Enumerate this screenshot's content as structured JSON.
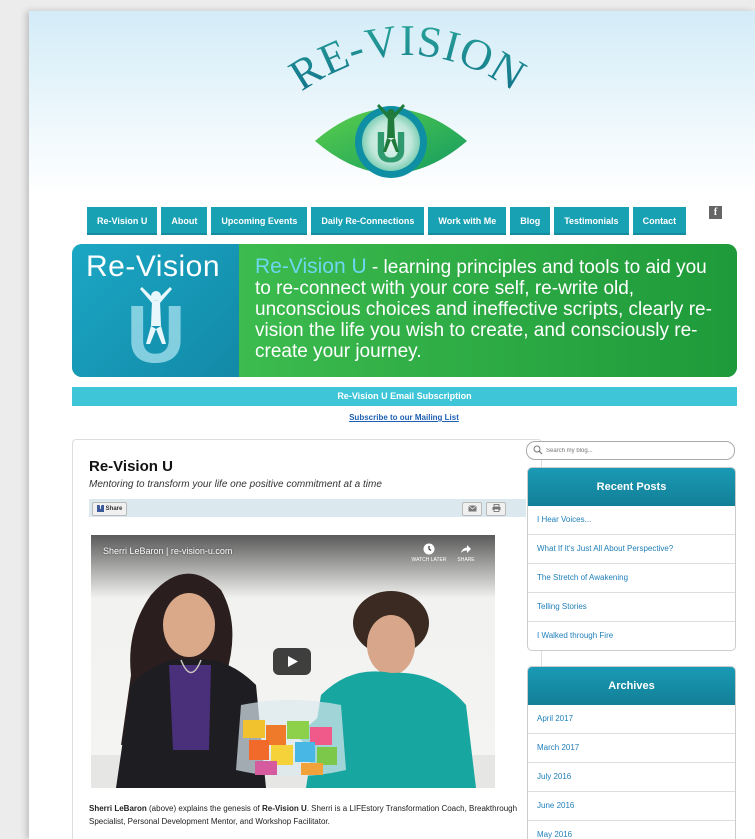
{
  "logo": {
    "title": "RE-VISION",
    "letter": "U"
  },
  "nav": {
    "items": [
      {
        "label": "Re-Vision U"
      },
      {
        "label": "About"
      },
      {
        "label": "Upcoming Events"
      },
      {
        "label": "Daily Re-Connections"
      },
      {
        "label": "Work with Me"
      },
      {
        "label": "Blog"
      },
      {
        "label": "Testimonials"
      },
      {
        "label": "Contact"
      }
    ],
    "facebook_glyph": "f"
  },
  "banner": {
    "logo_text": "Re-Vision",
    "logo_letter": "U",
    "lead": "Re-Vision U",
    "text": " - learning principles and tools to aid you to re-connect with your core self, re-write old, unconscious choices and ineffective scripts, clearly re-vision the life you wish to create, and consciously re-create your journey."
  },
  "email_bar": "Re-Vision U  Email Subscription",
  "subscribe_link": "Subscribe to our Mailing List",
  "post": {
    "title": "Re-Vision U",
    "subtitle": "Mentoring to transform your life one positive commitment at a time",
    "share_label": "Share",
    "video": {
      "title": "Sherri LeBaron | re-vision-u.com",
      "watch_later": "WATCH LATER",
      "share": "SHARE"
    },
    "caption": {
      "name": "Sherri LeBaron",
      "part1": " (above) explains the genesis of ",
      "brand": "Re-Vision U",
      "part2": ". Sherri is a LIFEstory Transformation Coach, Breakthrough Specialist, Personal Development Mentor, and Workshop Facilitator."
    }
  },
  "sidebar": {
    "search_placeholder": "Search my blog...",
    "recent_posts": {
      "title": "Recent Posts",
      "items": [
        {
          "label": "I Hear Voices..."
        },
        {
          "label": "What If It's Just All About Perspective?"
        },
        {
          "label": "The Stretch of Awakening"
        },
        {
          "label": "Telling Stories"
        },
        {
          "label": "I Walked through Fire"
        }
      ]
    },
    "archives": {
      "title": "Archives",
      "items": [
        {
          "label": "April 2017"
        },
        {
          "label": "March 2017"
        },
        {
          "label": "July 2016"
        },
        {
          "label": "June 2016"
        },
        {
          "label": "May 2016"
        }
      ]
    }
  },
  "colors": {
    "nav": "#18a0b3",
    "banner_green": "#2bb24c",
    "banner_teal": "#1289a7",
    "email_bar": "#3ec6d8",
    "link": "#1f7fb9"
  }
}
